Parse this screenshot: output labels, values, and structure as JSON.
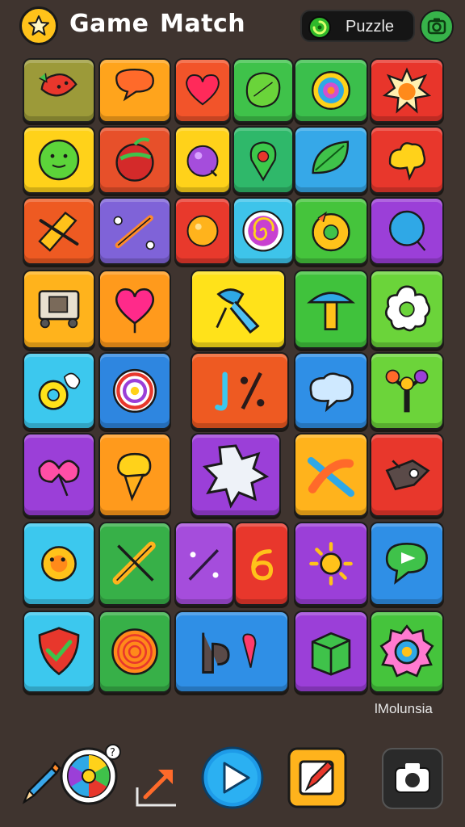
{
  "header": {
    "title_word1": "Game",
    "title_word2": "Match",
    "mode_label": "Puzzle",
    "icons": [
      "star-icon",
      "swirl-icon",
      "camera-icon"
    ]
  },
  "board": {
    "tiles": [
      {
        "name": "tile-strawberry",
        "color": "#9c9a39",
        "icon": "strawberry-icon"
      },
      {
        "name": "tile-speech-heart",
        "color": "#ffa41c",
        "icon": "speech-bubble-icon"
      },
      {
        "name": "tile-heart",
        "color": "#f2542a",
        "icon": "heart-icon"
      },
      {
        "name": "tile-leaf-blob",
        "color": "#3fc24a",
        "icon": "leaf-blob-icon"
      },
      {
        "name": "tile-target",
        "color": "#3bbf4c",
        "icon": "target-icon"
      },
      {
        "name": "tile-burst",
        "color": "#e8352b",
        "icon": "burst-icon"
      },
      {
        "name": "tile-green-ball",
        "color": "#ffd21a",
        "icon": "green-ball-icon"
      },
      {
        "name": "tile-apple",
        "color": "#e7502a",
        "icon": "apple-icon"
      },
      {
        "name": "tile-plum",
        "color": "#ffd21a",
        "icon": "plum-icon"
      },
      {
        "name": "tile-map-pin",
        "color": "#2fb86a",
        "icon": "map-pin-icon"
      },
      {
        "name": "tile-leaf",
        "color": "#36a8e8",
        "icon": "leaf-icon"
      },
      {
        "name": "tile-flame",
        "color": "#e8372c",
        "icon": "flame-icon"
      },
      {
        "name": "tile-cross-sticks",
        "color": "#ee5a22",
        "icon": "cross-sticks-icon"
      },
      {
        "name": "tile-slingshot",
        "color": "#7f63d8",
        "icon": "slingshot-icon"
      },
      {
        "name": "tile-orange-ball",
        "color": "#e8392c",
        "icon": "orange-ball-icon"
      },
      {
        "name": "tile-lollipop-swirl",
        "color": "#3ec4ea",
        "icon": "lollipop-swirl-icon"
      },
      {
        "name": "tile-donut",
        "color": "#45c43c",
        "icon": "donut-icon"
      },
      {
        "name": "tile-balloon",
        "color": "#9b3fd8",
        "icon": "balloon-icon"
      },
      {
        "name": "tile-cart",
        "color": "#ffb31c",
        "icon": "cart-icon"
      },
      {
        "name": "tile-heart-balloon",
        "color": "#ff9a1c",
        "icon": "heart-balloon-icon"
      },
      {
        "name": "tile-hammer",
        "color": "#ffe21a",
        "icon": "hammer-icon"
      },
      {
        "name": "tile-mushroom",
        "color": "#40c23c",
        "icon": "mushroom-icon"
      },
      {
        "name": "tile-flower",
        "color": "#6bd43a",
        "icon": "flower-icon"
      },
      {
        "name": "tile-ring-splash",
        "color": "#3cc8ee",
        "icon": "ring-splash-icon"
      },
      {
        "name": "tile-swirl-candy",
        "color": "#2e86e0",
        "icon": "swirl-candy-icon"
      },
      {
        "name": "tile-percent",
        "color": "#ee5a22",
        "icon": "percent-icon"
      },
      {
        "name": "tile-cloud-bubble",
        "color": "#2f8fe6",
        "icon": "cloud-bubble-icon"
      },
      {
        "name": "tile-joystick",
        "color": "#6cd43a",
        "icon": "joystick-icon"
      },
      {
        "name": "tile-pink-bow",
        "color": "#9b3fd8",
        "icon": "bow-icon"
      },
      {
        "name": "tile-ice-cream",
        "color": "#ff9a1c",
        "icon": "ice-cream-icon"
      },
      {
        "name": "tile-star-burst",
        "color": "#9b3fd8",
        "icon": "star-burst-icon"
      },
      {
        "name": "tile-crossed-bones",
        "color": "#ffb31c",
        "icon": "crossed-bones-icon"
      },
      {
        "name": "tile-rocket",
        "color": "#e8372c",
        "icon": "rocket-icon"
      },
      {
        "name": "tile-sun-gear",
        "color": "#3cc8ee",
        "icon": "sun-gear-icon"
      },
      {
        "name": "tile-baton",
        "color": "#37b048",
        "icon": "baton-icon"
      },
      {
        "name": "tile-percent-purple",
        "color": "#a54ddc",
        "icon": "slash-dots-icon"
      },
      {
        "name": "tile-six",
        "color": "#e8372c",
        "icon": "six-icon"
      },
      {
        "name": "tile-sun-ring",
        "color": "#9b3fd8",
        "icon": "sun-ring-icon"
      },
      {
        "name": "tile-flag-bubble",
        "color": "#2f8fe6",
        "icon": "flag-bubble-icon"
      },
      {
        "name": "tile-shield",
        "color": "#3cc8ee",
        "icon": "shield-icon"
      },
      {
        "name": "tile-spiral",
        "color": "#37b048",
        "icon": "spiral-icon"
      },
      {
        "name": "tile-d-letter",
        "color": "#2f8fe6",
        "icon": "d-letter-icon"
      },
      {
        "name": "tile-cube",
        "color": "#9b3fd8",
        "icon": "cube-icon"
      },
      {
        "name": "tile-gear",
        "color": "#45c43c",
        "icon": "gear-icon"
      }
    ]
  },
  "watermark": "lMolunsia",
  "toolbar": {
    "icons": [
      "pencil-icon",
      "wheel-icon",
      "export-icon",
      "play-icon",
      "edit-icon",
      "camera-icon"
    ]
  }
}
